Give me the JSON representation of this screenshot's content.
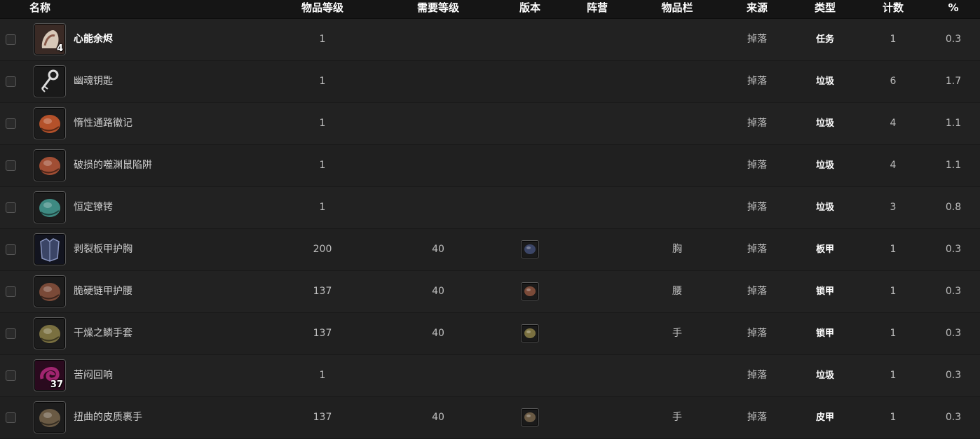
{
  "headers": {
    "name": "名称",
    "item_level": "物品等级",
    "req_level": "需要等级",
    "version": "版本",
    "faction": "阵营",
    "slot": "物品栏",
    "source": "来源",
    "type": "类型",
    "count": "计数",
    "percent": "%"
  },
  "rows": [
    {
      "name": "心能余烬",
      "item_level": "1",
      "req_level": "",
      "version_icon": "",
      "slot": "",
      "source": "掉落",
      "type": "任务",
      "count": "1",
      "percent": "0.3",
      "stack": "4",
      "icon": "anima-ember-icon",
      "color": "#8a5a4a",
      "highlight": true
    },
    {
      "name": "幽魂钥匙",
      "item_level": "1",
      "req_level": "",
      "version_icon": "",
      "slot": "",
      "source": "掉落",
      "type": "垃圾",
      "count": "6",
      "percent": "1.7",
      "stack": "",
      "icon": "ghostly-key-icon",
      "color": "#9a9a9a",
      "highlight": false
    },
    {
      "name": "惰性通路徽记",
      "item_level": "1",
      "req_level": "",
      "version_icon": "",
      "slot": "",
      "source": "掉落",
      "type": "垃圾",
      "count": "4",
      "percent": "1.1",
      "stack": "",
      "icon": "inert-sigil-icon",
      "color": "#b4512a",
      "highlight": false
    },
    {
      "name": "破损的噬渊鼠陷阱",
      "item_level": "1",
      "req_level": "",
      "version_icon": "",
      "slot": "",
      "source": "掉落",
      "type": "垃圾",
      "count": "4",
      "percent": "1.1",
      "stack": "",
      "icon": "broken-trap-icon",
      "color": "#a14e34",
      "highlight": false
    },
    {
      "name": "恒定镣铐",
      "item_level": "1",
      "req_level": "",
      "version_icon": "",
      "slot": "",
      "source": "掉落",
      "type": "垃圾",
      "count": "3",
      "percent": "0.8",
      "stack": "",
      "icon": "shackle-icon",
      "color": "#3e8a82",
      "highlight": false
    },
    {
      "name": "剥裂板甲护胸",
      "item_level": "200",
      "req_level": "40",
      "version_icon": "chest-version-icon",
      "slot": "胸",
      "source": "掉落",
      "type": "板甲",
      "count": "1",
      "percent": "0.3",
      "stack": "",
      "icon": "plate-chest-icon",
      "color": "#3b4566",
      "highlight": false
    },
    {
      "name": "脆硬链甲护腰",
      "item_level": "137",
      "req_level": "40",
      "version_icon": "waist-version-icon",
      "slot": "腰",
      "source": "掉落",
      "type": "锁甲",
      "count": "1",
      "percent": "0.3",
      "stack": "",
      "icon": "mail-belt-icon",
      "color": "#7a4a38",
      "highlight": false
    },
    {
      "name": "干燥之鳞手套",
      "item_level": "137",
      "req_level": "40",
      "version_icon": "gloves-version-icon",
      "slot": "手",
      "source": "掉落",
      "type": "锁甲",
      "count": "1",
      "percent": "0.3",
      "stack": "",
      "icon": "scale-gloves-icon",
      "color": "#7a7040",
      "highlight": false
    },
    {
      "name": "苦闷回响",
      "item_level": "1",
      "req_level": "",
      "version_icon": "",
      "slot": "",
      "source": "掉落",
      "type": "垃圾",
      "count": "1",
      "percent": "0.3",
      "stack": "37",
      "icon": "anguish-echo-icon",
      "color": "#a0256f",
      "highlight": false
    },
    {
      "name": "扭曲的皮质裹手",
      "item_level": "137",
      "req_level": "40",
      "version_icon": "leather-gloves-version-icon",
      "slot": "手",
      "source": "掉落",
      "type": "皮甲",
      "count": "1",
      "percent": "0.3",
      "stack": "",
      "icon": "leather-gloves-icon",
      "color": "#6a5a44",
      "highlight": false
    }
  ]
}
